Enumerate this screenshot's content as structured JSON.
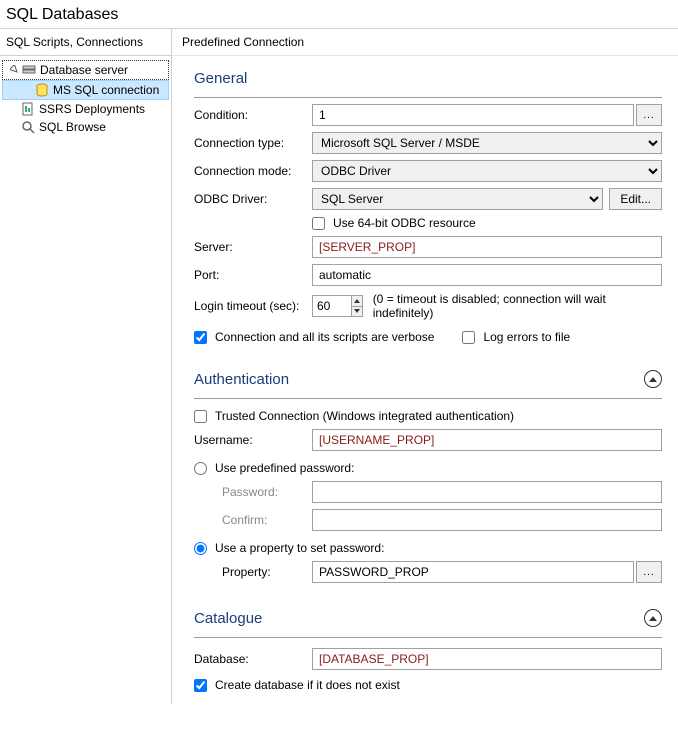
{
  "window_title": "SQL Databases",
  "tree_header": "SQL Scripts, Connections",
  "content_header": "Predefined Connection",
  "tree": {
    "items": [
      {
        "label": "Database server"
      },
      {
        "label": "MS SQL connection"
      },
      {
        "label": "SSRS Deployments"
      },
      {
        "label": "SQL Browse"
      }
    ]
  },
  "general": {
    "title": "General",
    "labels": {
      "condition": "Condition:",
      "connection_type": "Connection type:",
      "connection_mode": "Connection mode:",
      "odbc_driver": "ODBC Driver:",
      "server": "Server:",
      "port": "Port:",
      "login_timeout": "Login timeout (sec):"
    },
    "values": {
      "condition": "1",
      "connection_type": "Microsoft SQL Server / MSDE",
      "connection_mode": "ODBC Driver",
      "odbc_driver": "SQL Server",
      "server": "[SERVER_PROP]",
      "port": "automatic",
      "login_timeout": "60"
    },
    "edit_btn": "Edit...",
    "use_64bit": "Use 64-bit ODBC resource",
    "timeout_hint": "(0 = timeout is disabled; connection will wait indefinitely)",
    "verbose": "Connection and all its scripts are verbose",
    "log_errors": "Log errors to file"
  },
  "auth": {
    "title": "Authentication",
    "trusted": "Trusted Connection (Windows integrated authentication)",
    "labels": {
      "username": "Username:",
      "use_predefined": "Use predefined password:",
      "password": "Password:",
      "confirm": "Confirm:",
      "use_property": "Use a property to set password:",
      "property": "Property:"
    },
    "values": {
      "username": "[USERNAME_PROP]",
      "password": "",
      "confirm": "",
      "property": "PASSWORD_PROP"
    }
  },
  "catalogue": {
    "title": "Catalogue",
    "labels": {
      "database": "Database:"
    },
    "values": {
      "database": "[DATABASE_PROP]"
    },
    "create_if_missing": "Create database if it does not exist"
  }
}
